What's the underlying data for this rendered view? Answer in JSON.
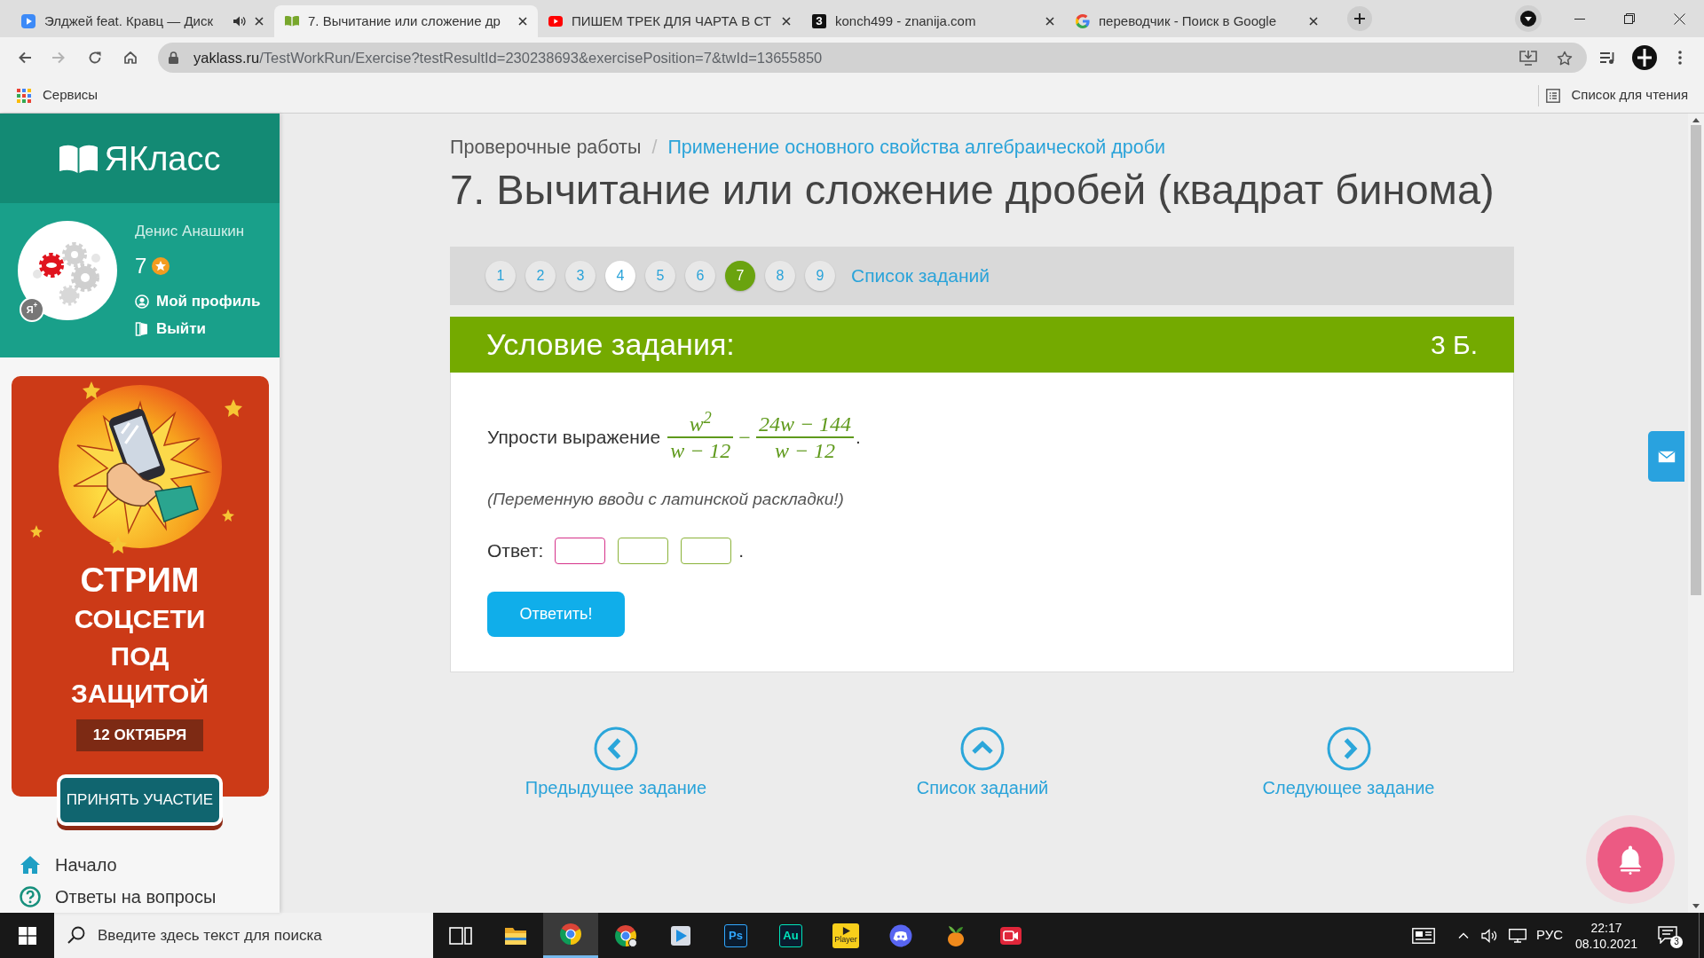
{
  "browser": {
    "tabs": [
      {
        "title": "Элджей feat. Кравц — Диск",
        "selected": false,
        "audio": true
      },
      {
        "title": "7. Вычитание или сложение др",
        "selected": true,
        "audio": false
      },
      {
        "title": "ПИШЕМ ТРЕК ДЛЯ ЧАРТА В СТ",
        "selected": false,
        "audio": false
      },
      {
        "title": "konch499 - znanija.com",
        "selected": false,
        "audio": false,
        "icon_text": "З"
      },
      {
        "title": "переводчик - Поиск в Google",
        "selected": false,
        "audio": false
      }
    ],
    "nav_buttons": [
      {
        "kind": "back",
        "disabled": false
      },
      {
        "kind": "forward",
        "disabled": true
      },
      {
        "kind": "reload",
        "disabled": false
      },
      {
        "kind": "home",
        "disabled": false
      }
    ],
    "url": {
      "host": "yaklass.ru",
      "path": "/TestWorkRun/Exercise?testResultId=230238693&exercisePosition=7&twId=13655850"
    },
    "bookmarks": [
      {
        "label": "Сервисы"
      }
    ],
    "reading_list": "Список для чтения"
  },
  "sidebar": {
    "logo": "ЯКласс",
    "user": {
      "name": "Денис Анашкин",
      "score": "7",
      "badge": "Я$^{+}$",
      "links": [
        {
          "kind": "profile",
          "label": "Мой профиль"
        },
        {
          "kind": "logout",
          "label": "Выйти"
        }
      ]
    },
    "ad": {
      "headline": [
        "СТРИМ",
        "СОЦСЕТИ",
        "ПОД",
        "ЗАЩИТОЙ"
      ],
      "date": "12 ОКТЯБРЯ",
      "button": "ПРИНЯТЬ УЧАСТИЕ"
    },
    "nav": [
      {
        "kind": "home",
        "label": "Начало"
      },
      {
        "kind": "help",
        "label": "Ответы на вопросы"
      }
    ]
  },
  "main": {
    "breadcrumb": [
      {
        "label": "Проверочные работы",
        "link": false
      },
      {
        "label": "Применение основного свойства алгебраической дроби",
        "link": true
      }
    ],
    "breadcrumb_separator": "/",
    "title": "7. Вычитание или сложение дробей (квадрат бинома)",
    "pager": {
      "items": [
        {
          "label": "1",
          "selected": false,
          "highlighted": false
        },
        {
          "label": "2",
          "selected": false,
          "highlighted": false
        },
        {
          "label": "3",
          "selected": false,
          "highlighted": false
        },
        {
          "label": "4",
          "selected": false,
          "highlighted": true
        },
        {
          "label": "5",
          "selected": false,
          "highlighted": false
        },
        {
          "label": "6",
          "selected": false,
          "highlighted": false
        },
        {
          "label": "7",
          "selected": true,
          "highlighted": false
        },
        {
          "label": "8",
          "selected": false,
          "highlighted": false
        },
        {
          "label": "9",
          "selected": false,
          "highlighted": false
        }
      ],
      "list_link": "Список заданий"
    },
    "task": {
      "header": "Условие задания:",
      "points": "3 Б.",
      "prompt": "Упрости выражение",
      "fractions": [
        {
          "numerator": "w$^{2}$",
          "denominator": "w − 12"
        },
        {
          "numerator": "24w − 144",
          "denominator": "w − 12"
        }
      ],
      "operator": "−",
      "end": ".",
      "hint": "(Переменную вводи с латинской раскладки!)",
      "answer_label": "Ответ:",
      "answer_fields": [
        {
          "focused": true
        },
        {
          "focused": false
        },
        {
          "focused": false
        }
      ],
      "answer_end": ".",
      "submit": "Ответить!"
    },
    "bottom_nav": [
      {
        "kind": "prev",
        "label": "Предыдущее задание"
      },
      {
        "kind": "list",
        "label": "Список заданий"
      },
      {
        "kind": "next",
        "label": "Следующее задание"
      }
    ]
  },
  "taskbar": {
    "search_placeholder": "Введите здесь текст для поиска",
    "apps": [
      {
        "kind": "task-view",
        "active": false
      },
      {
        "kind": "folder",
        "active": false
      },
      {
        "kind": "browser",
        "active": true
      },
      {
        "kind": "browser-profile",
        "active": false
      },
      {
        "kind": "play",
        "active": false
      },
      {
        "kind": "tile",
        "label": "Ps",
        "color": "#31a8ff",
        "active": false
      },
      {
        "kind": "tile",
        "label": "Au",
        "color": "#00e4bb",
        "active": false
      },
      {
        "kind": "player",
        "label": "Player",
        "active": false
      },
      {
        "kind": "chat",
        "active": false
      },
      {
        "kind": "fruit",
        "active": false
      },
      {
        "kind": "record",
        "active": false
      }
    ],
    "language": "РУС",
    "time": "22:17",
    "date": "08.10.2021",
    "notifications": "3"
  }
}
